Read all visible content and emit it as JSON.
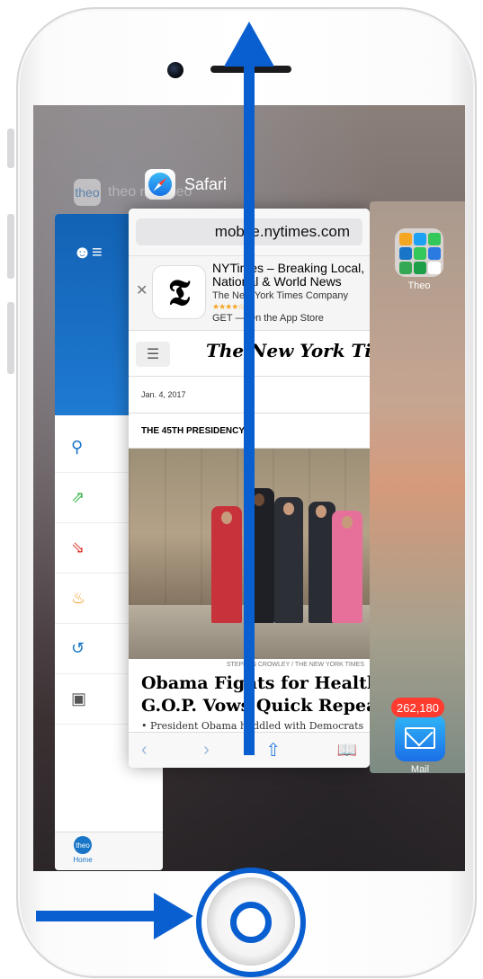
{
  "app_switcher": {
    "theo_app": {
      "label": "theo myTheo",
      "icon_text": "theo",
      "tab_home_logo": "theo",
      "tab_home_label": "Home",
      "nav_icons": [
        "search-icon",
        "chart-up-icon",
        "chart-down-icon",
        "flame-icon",
        "history-icon",
        "monitor-chart-icon"
      ]
    },
    "safari": {
      "label": "Safari",
      "url": "mobile.nytimes.com",
      "app_banner": {
        "title": "NYTimes – Breaking Local, National & World News",
        "company": "The New York Times Company",
        "stars": "★★★★☆",
        "cta": "GET — On the App Store",
        "icon_text": "𝕿"
      },
      "masthead": "The New York Times",
      "date": "Jan. 4, 2017",
      "section": "THE 45TH PRESIDENCY",
      "photo_credit": "STEPHEN CROWLEY / THE NEW YORK TIMES",
      "headline_line1": "Obama Fights for Health Law",
      "headline_line2": "G.O.P. Vows Quick Repeal",
      "summary": "• President Obama huddled with Democrats"
    },
    "home_screen": {
      "folder_label": "Theo",
      "mail_label": "Mail",
      "mail_badge": "262,180"
    }
  },
  "colors": {
    "annotation_blue": "#0a5fd0",
    "theo_blue": "#1875c7",
    "badge_red": "#ff3b30"
  }
}
